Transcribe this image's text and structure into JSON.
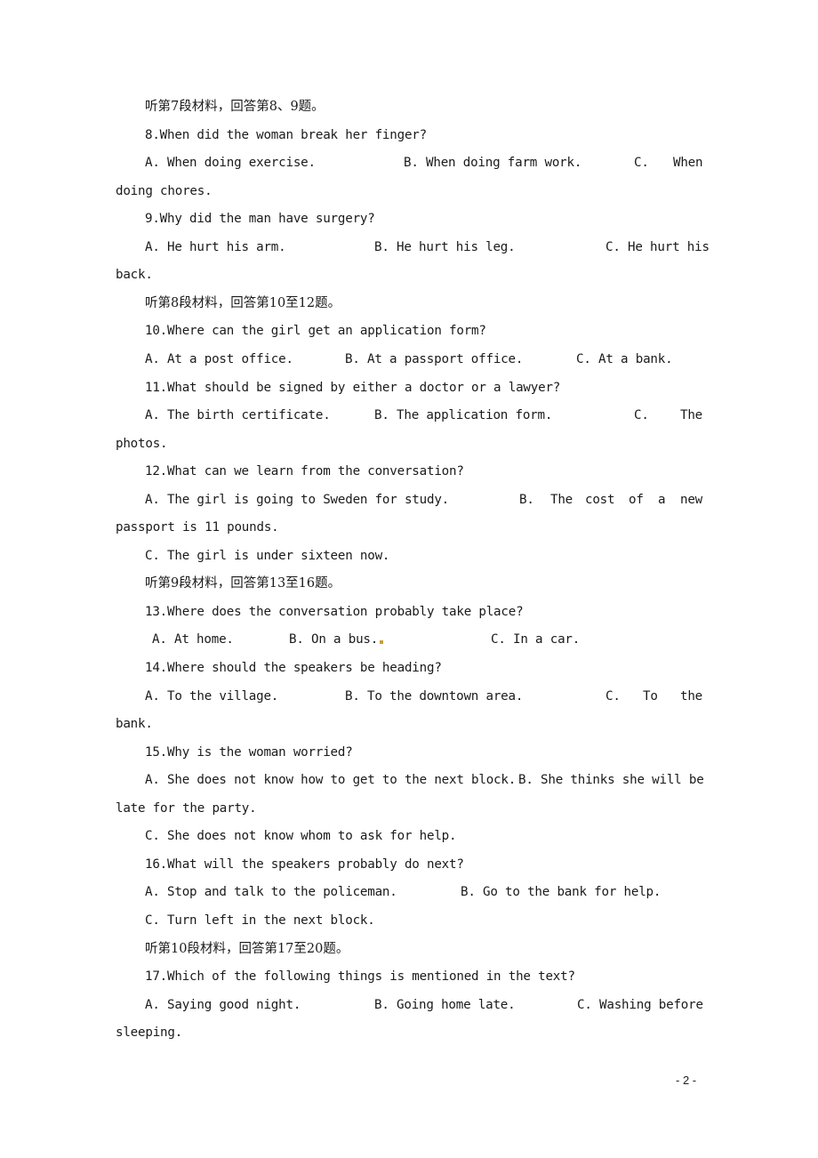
{
  "document": {
    "page_number": "- 2 -",
    "lines": [
      {
        "type": "section",
        "text": "听第7段材料，回答第8、9题。"
      },
      {
        "type": "question",
        "text": "8.When did the woman break her finger?"
      },
      {
        "type": "options",
        "segs": [
          "A. When doing exercise.",
          "B. When doing farm work.",
          "C.",
          "When"
        ]
      },
      {
        "type": "wrap",
        "text": "doing chores."
      },
      {
        "type": "question",
        "text": "9.Why did the man have surgery?"
      },
      {
        "type": "options",
        "segs": [
          "A. He hurt his arm.",
          "B. He hurt his leg.",
          "C. He hurt his"
        ]
      },
      {
        "type": "wrap",
        "text": "back."
      },
      {
        "type": "section",
        "text": "听第8段材料，回答第10至12题。"
      },
      {
        "type": "question",
        "text": "10.Where can the girl get an application form?"
      },
      {
        "type": "options",
        "segs": [
          "A. At a post office.",
          "B. At a passport office.",
          "C. At a bank."
        ]
      },
      {
        "type": "question",
        "text": "11.What should be signed by either a doctor or a lawyer?"
      },
      {
        "type": "options",
        "segs": [
          "A. The birth certificate.",
          "B. The application form.",
          "C.",
          "The"
        ]
      },
      {
        "type": "wrap",
        "text": "photos."
      },
      {
        "type": "question",
        "text": "12.What can we learn from the conversation?"
      },
      {
        "type": "options",
        "segs": [
          "A. The girl is going to Sweden for study.",
          "B.",
          "The",
          "cost",
          "of",
          "a",
          "new"
        ]
      },
      {
        "type": "wrap",
        "text": "passport is 11 pounds."
      },
      {
        "type": "option",
        "text": "C. The girl is under sixteen now."
      },
      {
        "type": "section",
        "text": "听第9段材料，回答第13至16题。"
      },
      {
        "type": "question",
        "text": "13.Where does the conversation probably take place?"
      },
      {
        "type": "options",
        "segs": [
          "A. At home.",
          "B. On a bus.",
          "C. In a car."
        ]
      },
      {
        "type": "question",
        "text": "14.Where should the speakers be heading?"
      },
      {
        "type": "options",
        "segs": [
          "A. To the village.",
          "B. To the downtown area.",
          "C.",
          "To",
          "the"
        ]
      },
      {
        "type": "wrap",
        "text": "bank."
      },
      {
        "type": "question",
        "text": "15.Why is the woman worried?"
      },
      {
        "type": "options",
        "segs": [
          "A. She does not know how to get to the next block.",
          "B. She thinks she will be"
        ]
      },
      {
        "type": "wrap",
        "text": "late for the party."
      },
      {
        "type": "option",
        "text": "C. She does not know whom to ask for help."
      },
      {
        "type": "question",
        "text": "16.What will the speakers probably do next?"
      },
      {
        "type": "options",
        "segs": [
          "A. Stop and talk to the policeman.",
          "B. Go to the bank for help."
        ]
      },
      {
        "type": "option",
        "text": "C. Turn left in the next block."
      },
      {
        "type": "section",
        "text": "听第10段材料，回答第17至20题。"
      },
      {
        "type": "question",
        "text": "17.Which of the following things is mentioned in the text?"
      },
      {
        "type": "options",
        "segs": [
          "A. Saying good night.",
          "B. Going home late.",
          "C. Washing before"
        ]
      },
      {
        "type": "wrap",
        "text": "sleeping."
      }
    ]
  }
}
